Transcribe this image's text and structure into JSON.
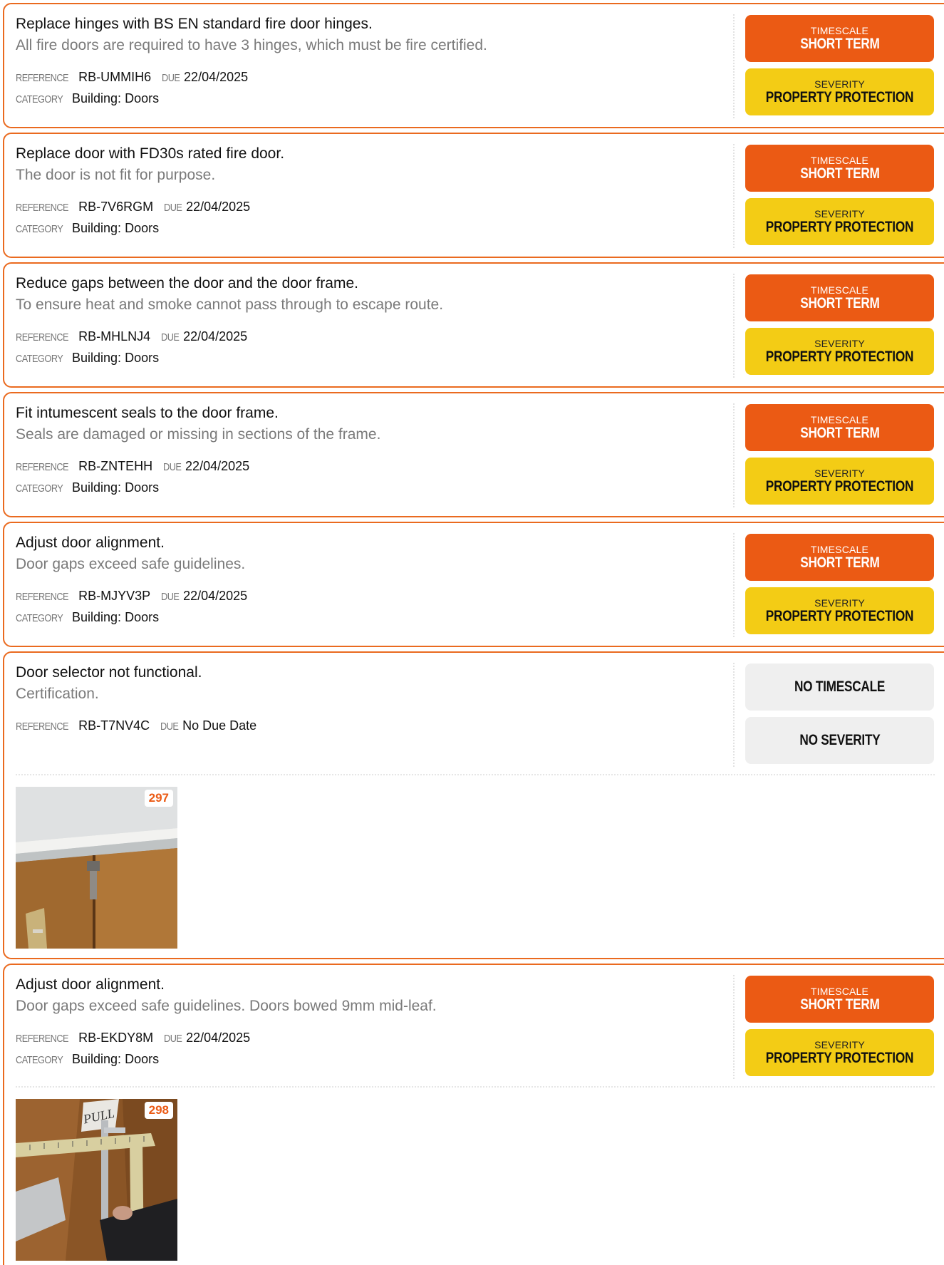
{
  "labels": {
    "reference": "REFERENCE",
    "due": "DUE",
    "category": "CATEGORY",
    "timescale": "TIMESCALE",
    "severity": "SEVERITY"
  },
  "colors": {
    "border": "#ea6a1f",
    "timescale_short": "#eb5a14",
    "severity_property": "#f3cc15",
    "none": "#efefef",
    "photo_number": "#eb5a14"
  },
  "items": [
    {
      "title": "Replace hinges with BS EN standard fire door hinges.",
      "description": "All fire doors are required to have 3 hinges, which must be fire certified.",
      "reference": "RB-UMMIH6",
      "due": "22/04/2025",
      "category": "Building: Doors",
      "timescale": "SHORT TERM",
      "severity": "PROPERTY PROTECTION"
    },
    {
      "title": "Replace door with FD30s rated fire door.",
      "description": "The door is not fit for purpose.",
      "reference": "RB-7V6RGM",
      "due": "22/04/2025",
      "category": "Building: Doors",
      "timescale": "SHORT TERM",
      "severity": "PROPERTY PROTECTION"
    },
    {
      "title": "Reduce gaps between the door and the door frame.",
      "description": "To ensure heat and smoke cannot pass through to escape route.",
      "reference": "RB-MHLNJ4",
      "due": "22/04/2025",
      "category": "Building: Doors",
      "timescale": "SHORT TERM",
      "severity": "PROPERTY PROTECTION"
    },
    {
      "title": "Fit intumescent seals to the door frame.",
      "description": "Seals are damaged or missing in sections of the frame.",
      "reference": "RB-ZNTEHH",
      "due": "22/04/2025",
      "category": "Building: Doors",
      "timescale": "SHORT TERM",
      "severity": "PROPERTY PROTECTION"
    },
    {
      "title": "Adjust door alignment.",
      "description": "Door gaps exceed safe guidelines.",
      "reference": "RB-MJYV3P",
      "due": "22/04/2025",
      "category": "Building: Doors",
      "timescale": "SHORT TERM",
      "severity": "PROPERTY PROTECTION"
    },
    {
      "title": "Door selector not functional.",
      "description": "Certification.",
      "reference": "RB-T7NV4C",
      "due": "No Due Date",
      "no_timescale": "NO TIMESCALE",
      "no_severity": "NO SEVERITY",
      "photo_number": "297"
    },
    {
      "title": "Adjust door alignment.",
      "description": "Door gaps exceed safe guidelines. Doors bowed 9mm mid-leaf.",
      "reference": "RB-EKDY8M",
      "due": "22/04/2025",
      "category": "Building: Doors",
      "timescale": "SHORT TERM",
      "severity": "PROPERTY PROTECTION",
      "photo_number": "298",
      "photo_sign_text": "PULL"
    }
  ]
}
